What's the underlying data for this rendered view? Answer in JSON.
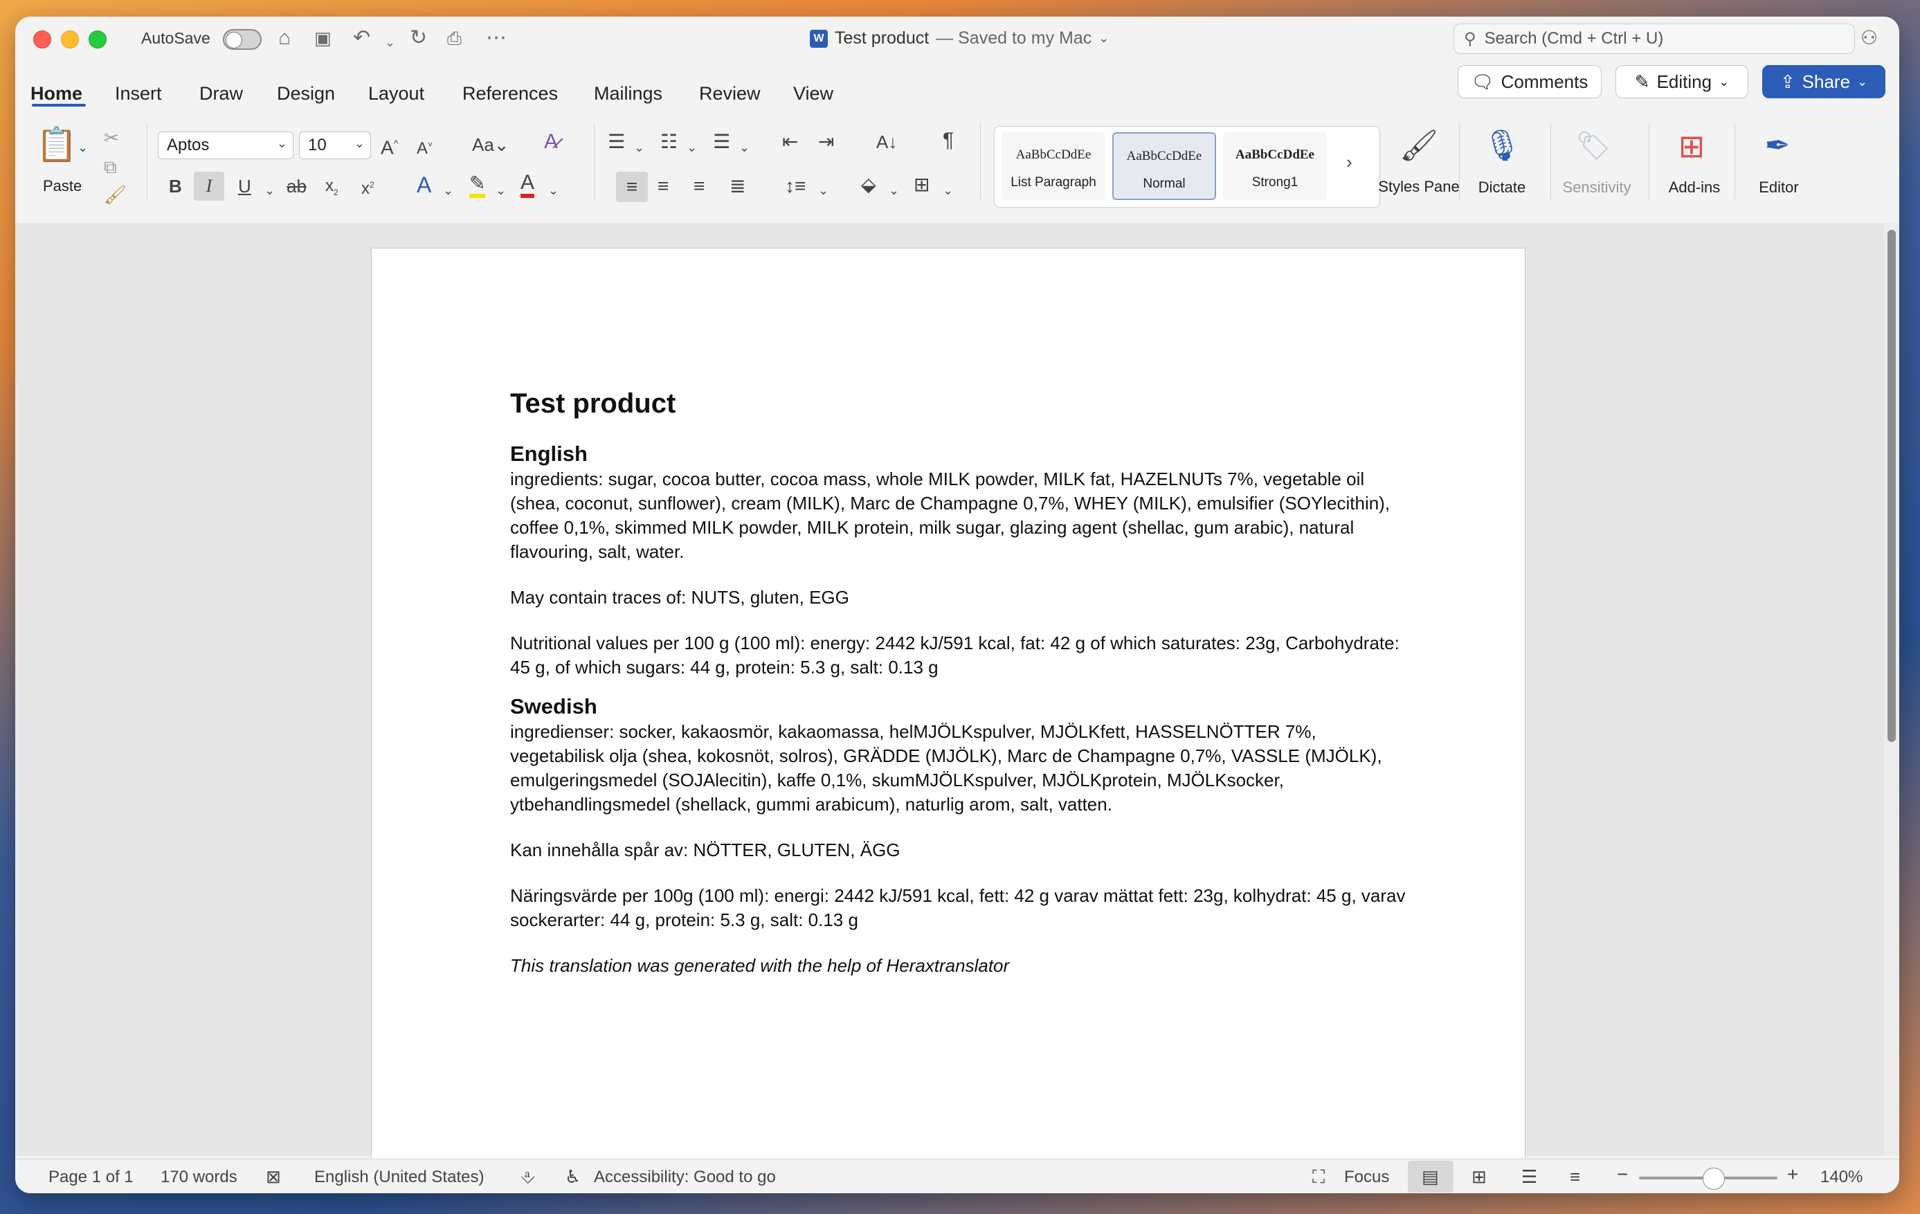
{
  "titlebar": {
    "autosave_label": "AutoSave",
    "doc_title": "Test product",
    "save_status": "— Saved to my Mac",
    "search_placeholder": "Search (Cmd + Ctrl + U)"
  },
  "tabs": [
    "Home",
    "Insert",
    "Draw",
    "Design",
    "Layout",
    "References",
    "Mailings",
    "Review",
    "View"
  ],
  "header_buttons": {
    "comments": "Comments",
    "editing": "Editing",
    "share": "Share"
  },
  "ribbon": {
    "paste": "Paste",
    "font_name": "Aptos",
    "font_size": "10",
    "styles": [
      {
        "sample": "AaBbCcDdEe",
        "name": "List Paragraph"
      },
      {
        "sample": "AaBbCcDdEe",
        "name": "Normal"
      },
      {
        "sample": "AaBbCcDdEe",
        "name": "Strong1"
      }
    ],
    "styles_pane": "Styles Pane",
    "dictate": "Dictate",
    "sensitivity": "Sensitivity",
    "addins": "Add-ins",
    "editor": "Editor"
  },
  "document": {
    "title": "Test product",
    "english_heading": "English",
    "english_ingredients": "ingredients: sugar, cocoa butter, cocoa mass, whole MILK powder, MILK fat, HAZELNUTs 7%, vegetable oil (shea, coconut, sunflower), cream (MILK), Marc de Champagne 0,7%, WHEY (MILK), emulsifier (SOYlecithin), coffee 0,1%, skimmed MILK powder, MILK protein, milk sugar, glazing agent (shellac, gum arabic), natural flavouring, salt, water.",
    "english_traces": "May contain traces of: NUTS, gluten, EGG",
    "english_nutrition": "Nutritional values per 100 g (100 ml): energy: 2442 kJ/591 kcal, fat: 42 g of which saturates: 23g, Carbohydrate: 45 g, of which sugars: 44 g, protein: 5.3 g, salt: 0.13 g",
    "swedish_heading": "Swedish",
    "swedish_ingredients": "ingredienser: socker, kakaosmör, kakaomassa, helMJÖLKspulver, MJÖLKfett, HASSELNÖTTER 7%, vegetabilisk olja (shea, kokosnöt, solros), GRÄDDE (MJÖLK), Marc de Champagne 0,7%, VASSLE (MJÖLK), emulgeringsmedel (SOJAlecitin), kaffe 0,1%, skumMJÖLKspulver, MJÖLKprotein, MJÖLKsocker, ytbehandlingsmedel (shellack, gummi arabicum), naturlig arom, salt, vatten.",
    "swedish_traces": "Kan innehålla spår av: NÖTTER, GLUTEN, ÄGG",
    "swedish_nutrition": "Näringsvärde per 100g (100 ml): energi: 2442 kJ/591 kcal, fett: 42 g varav mättat fett: 23g, kolhydrat: 45 g, varav sockerarter: 44 g, protein: 5.3 g, salt: 0.13 g",
    "translation_note": "This translation was generated with the help of Heraxtranslator"
  },
  "statusbar": {
    "page": "Page 1 of 1",
    "words": "170 words",
    "language": "English (United States)",
    "accessibility": "Accessibility: Good to go",
    "focus": "Focus",
    "zoom": "140%"
  }
}
